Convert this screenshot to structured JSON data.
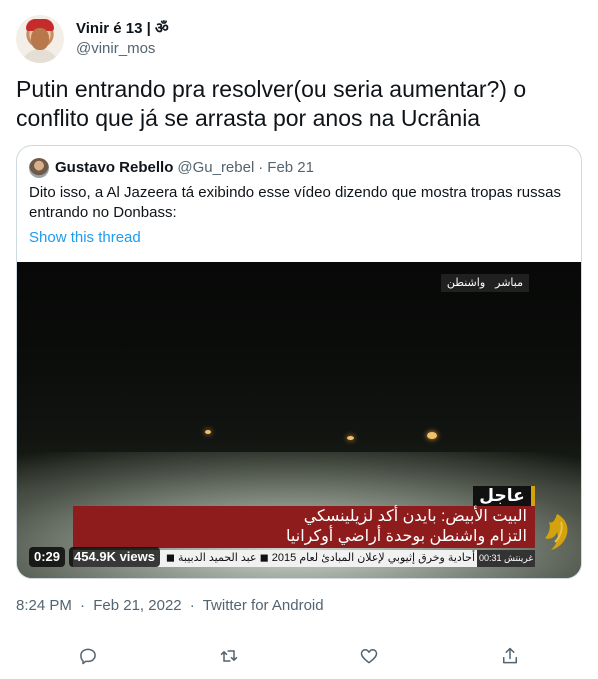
{
  "author": {
    "display_name": "Vinir é 13 | ",
    "name_glyph": "ॐ",
    "handle": "@vinir_mos"
  },
  "tweet": {
    "text": "Putin entrando pra resolver(ou seria aumentar?) o conflito que já se arrasta por anos na Ucrânia",
    "time": "8:24 PM",
    "separator": "·",
    "date": "Feb 21, 2022",
    "source": "Twitter for Android"
  },
  "quote": {
    "name": "Gustavo Rebello",
    "handle": "@Gu_rebel",
    "separator": "·",
    "date": "Feb 21",
    "text": "Dito isso, a Al Jazeera tá exibindo esse vídeo dizendo que mostra tropas russas entrando no Donbass:",
    "show_thread": "Show this thread"
  },
  "video": {
    "live_label": "مباشر",
    "location_label": "واشنطن",
    "breaking_label": "عاجل",
    "headline_line1": "البيت الأبيض: بايدن أكد لزيلينسكي",
    "headline_line2": "التزام واشنطن بوحدة أراضي أوكرانيا",
    "ticker_text": "أحادية وخرق إثيوبي لإعلان المبادئ لعام 2015 ◼ عبد الحميد الدبيبة ◼",
    "ticker_time": "غرينتش 00:31",
    "duration": "0:29",
    "views": "454.9K views"
  },
  "actions": {
    "reply": "reply-icon",
    "retweet": "retweet-icon",
    "like": "like-icon",
    "share": "share-icon"
  },
  "colors": {
    "text": "#0f1419",
    "secondary": "#536471",
    "link": "#1d9bf0",
    "border": "#cfd9de",
    "ticker_red": "#8f1c1c"
  }
}
